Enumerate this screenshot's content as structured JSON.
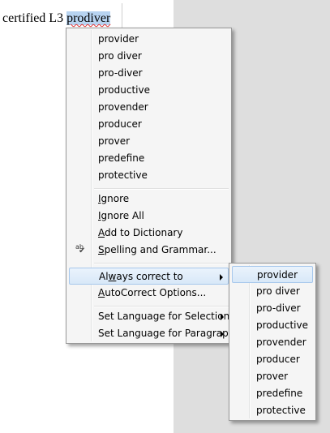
{
  "document": {
    "text_before": "certified L3 ",
    "misspelled_word": "prodiver"
  },
  "context_menu": {
    "suggestions": [
      "provider",
      "pro diver",
      "pro-diver",
      "productive",
      "provender",
      "producer",
      "prover",
      "predefine",
      "protective"
    ],
    "ignore": {
      "pre": "",
      "u": "I",
      "post": "gnore"
    },
    "ignore_all": {
      "pre": "",
      "u": "I",
      "post": "gnore All"
    },
    "add_to_dictionary": {
      "pre": "",
      "u": "A",
      "post": "dd to Dictionary"
    },
    "spelling_grammar": {
      "pre": "",
      "u": "S",
      "post": "pelling and Grammar..."
    },
    "spelling_icon_text": "ab",
    "spelling_icon_check": "✔",
    "always_correct": {
      "pre": "Al",
      "u": "w",
      "post": "ays correct to"
    },
    "autocorrect_options": {
      "pre": "",
      "u": "A",
      "post": "utoCorrect Options..."
    },
    "set_language_selection": "Set Language for Selection",
    "set_language_paragraph": "Set Language for Paragraph"
  },
  "submenu": {
    "items": [
      "provider",
      "pro diver",
      "pro-diver",
      "productive",
      "provender",
      "producer",
      "prover",
      "predefine",
      "protective"
    ]
  },
  "colors": {
    "selection": "#b7d3f0",
    "highlight": "#d8e8f8",
    "pasteboard": "#dedede"
  }
}
